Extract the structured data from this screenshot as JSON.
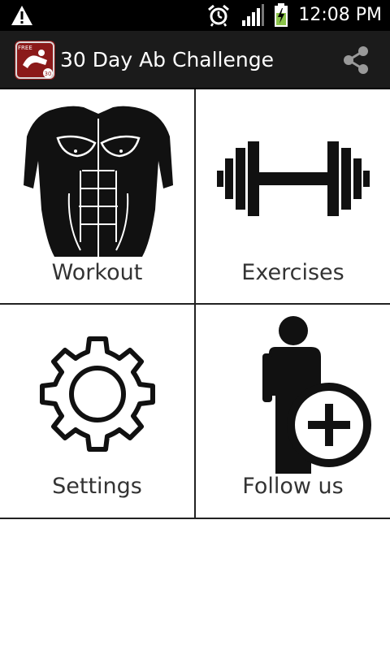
{
  "status_bar": {
    "time": "12:08 PM",
    "icons": [
      "warning-icon",
      "alarm-icon",
      "signal-icon",
      "battery-charging-icon"
    ]
  },
  "action_bar": {
    "title": "30 Day Ab Challenge",
    "app_icon": "app-icon",
    "app_icon_badge_top": "FREE",
    "app_icon_badge_bottom": "30",
    "share_icon": "share-icon"
  },
  "tiles": [
    {
      "label": "Workout",
      "icon": "torso-icon"
    },
    {
      "label": "Exercises",
      "icon": "dumbbell-icon"
    },
    {
      "label": "Settings",
      "icon": "gear-icon"
    },
    {
      "label": "Follow us",
      "icon": "add-person-icon"
    }
  ],
  "colors": {
    "status_bar": "#000000",
    "action_bar": "#1b1b1b",
    "app_icon_bg": "#8b1a1a",
    "tile_label": "#333333",
    "divider": "#222222",
    "battery": "#8bc34a"
  }
}
